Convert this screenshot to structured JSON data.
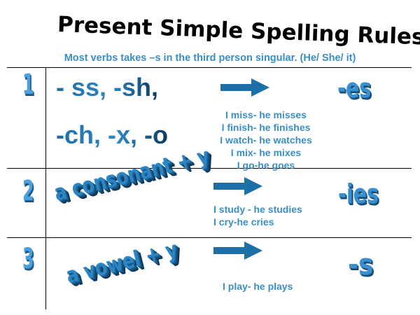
{
  "slide": {
    "title": "Present Simple Spelling Rules",
    "subtitle": "Most verbs takes –s in the third person singular. (He/ She/ it)"
  },
  "rules": [
    {
      "number": "1",
      "pattern_line1": "- ss, -sh,",
      "pattern_line2": "-ch, -x, -o",
      "ending": "-es",
      "examples": [
        "I miss- he misses",
        "I finish- he finishes",
        "I watch- he watches",
        "I mix- he mixes",
        "I go-he goes"
      ]
    },
    {
      "number": "2",
      "pattern": "a consonant + y",
      "ending": "-ies",
      "examples": [
        "I study - he studies",
        "I cry-he cries"
      ]
    },
    {
      "number": "3",
      "pattern": "a vowel + y",
      "ending": "-s",
      "examples": [
        "I play- he plays"
      ]
    }
  ],
  "colors": {
    "arrow": "#1d6fa8",
    "wordart": "#2d86c4",
    "example_text": "#3a8ec8"
  }
}
